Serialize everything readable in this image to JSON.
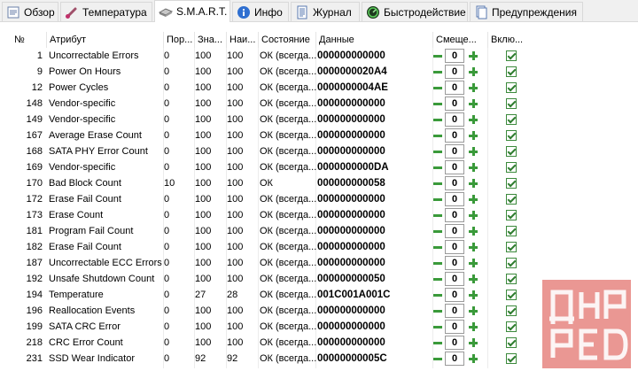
{
  "tabs": [
    {
      "label": "Обзор",
      "icon": "overview-icon",
      "active": false
    },
    {
      "label": "Температура",
      "icon": "thermometer-icon",
      "active": false
    },
    {
      "label": "S.M.A.R.T.",
      "icon": "drive-icon",
      "active": true
    },
    {
      "label": "Инфо",
      "icon": "info-icon",
      "active": false
    },
    {
      "label": "Журнал",
      "icon": "journal-icon",
      "active": false
    },
    {
      "label": "Быстродействие",
      "icon": "speed-icon",
      "active": false
    },
    {
      "label": "Предупреждения",
      "icon": "warnings-icon",
      "active": false
    }
  ],
  "columns": [
    "№",
    "Атрибут",
    "Пор...",
    "Зна...",
    "Наи...",
    "Состояние",
    "Данные",
    "Смеще...",
    "Вклю..."
  ],
  "rows": [
    {
      "num": "1",
      "attr": "Uncorrectable Errors",
      "por": "0",
      "zn": "100",
      "na": "100",
      "st": "ОК (всегда...",
      "dat": "000000000000",
      "off": "0"
    },
    {
      "num": "9",
      "attr": "Power On Hours",
      "por": "0",
      "zn": "100",
      "na": "100",
      "st": "ОК (всегда...",
      "dat": "0000000020A4",
      "off": "0"
    },
    {
      "num": "12",
      "attr": "Power Cycles",
      "por": "0",
      "zn": "100",
      "na": "100",
      "st": "ОК (всегда...",
      "dat": "0000000004AE",
      "off": "0"
    },
    {
      "num": "148",
      "attr": "Vendor-specific",
      "por": "0",
      "zn": "100",
      "na": "100",
      "st": "ОК (всегда...",
      "dat": "000000000000",
      "off": "0"
    },
    {
      "num": "149",
      "attr": "Vendor-specific",
      "por": "0",
      "zn": "100",
      "na": "100",
      "st": "ОК (всегда...",
      "dat": "000000000000",
      "off": "0"
    },
    {
      "num": "167",
      "attr": "Average Erase Count",
      "por": "0",
      "zn": "100",
      "na": "100",
      "st": "ОК (всегда...",
      "dat": "000000000000",
      "off": "0"
    },
    {
      "num": "168",
      "attr": "SATA PHY Error Count",
      "por": "0",
      "zn": "100",
      "na": "100",
      "st": "ОК (всегда...",
      "dat": "000000000000",
      "off": "0"
    },
    {
      "num": "169",
      "attr": "Vendor-specific",
      "por": "0",
      "zn": "100",
      "na": "100",
      "st": "ОК (всегда...",
      "dat": "0000000000DA",
      "off": "0"
    },
    {
      "num": "170",
      "attr": "Bad Block Count",
      "por": "10",
      "zn": "100",
      "na": "100",
      "st": "ОК",
      "dat": "000000000058",
      "off": "0"
    },
    {
      "num": "172",
      "attr": "Erase Fail Count",
      "por": "0",
      "zn": "100",
      "na": "100",
      "st": "ОК (всегда...",
      "dat": "000000000000",
      "off": "0"
    },
    {
      "num": "173",
      "attr": "Erase Count",
      "por": "0",
      "zn": "100",
      "na": "100",
      "st": "ОК (всегда...",
      "dat": "000000000000",
      "off": "0"
    },
    {
      "num": "181",
      "attr": "Program Fail Count",
      "por": "0",
      "zn": "100",
      "na": "100",
      "st": "ОК (всегда...",
      "dat": "000000000000",
      "off": "0"
    },
    {
      "num": "182",
      "attr": "Erase Fail Count",
      "por": "0",
      "zn": "100",
      "na": "100",
      "st": "ОК (всегда...",
      "dat": "000000000000",
      "off": "0"
    },
    {
      "num": "187",
      "attr": "Uncorrectable ECC Errors",
      "por": "0",
      "zn": "100",
      "na": "100",
      "st": "ОК (всегда...",
      "dat": "000000000000",
      "off": "0"
    },
    {
      "num": "192",
      "attr": "Unsafe Shutdown Count",
      "por": "0",
      "zn": "100",
      "na": "100",
      "st": "ОК (всегда...",
      "dat": "000000000050",
      "off": "0"
    },
    {
      "num": "194",
      "attr": "Temperature",
      "por": "0",
      "zn": "27",
      "na": "28",
      "st": "ОК (всегда...",
      "dat": "001C001A001C",
      "off": "0"
    },
    {
      "num": "196",
      "attr": "Reallocation Events",
      "por": "0",
      "zn": "100",
      "na": "100",
      "st": "ОК (всегда...",
      "dat": "000000000000",
      "off": "0"
    },
    {
      "num": "199",
      "attr": "SATA CRC Error",
      "por": "0",
      "zn": "100",
      "na": "100",
      "st": "ОК (всегда...",
      "dat": "000000000000",
      "off": "0"
    },
    {
      "num": "218",
      "attr": "CRC Error Count",
      "por": "0",
      "zn": "100",
      "na": "100",
      "st": "ОК (всегда...",
      "dat": "000000000000",
      "off": "0"
    },
    {
      "num": "231",
      "attr": "SSD Wear Indicator",
      "por": "0",
      "zn": "92",
      "na": "92",
      "st": "ОК (всегда...",
      "dat": "00000000005C",
      "off": "0"
    }
  ],
  "watermark": {
    "text": "ДНР РЕД",
    "color": "#d9423a"
  },
  "colors": {
    "accent": "#3a9a3a"
  }
}
